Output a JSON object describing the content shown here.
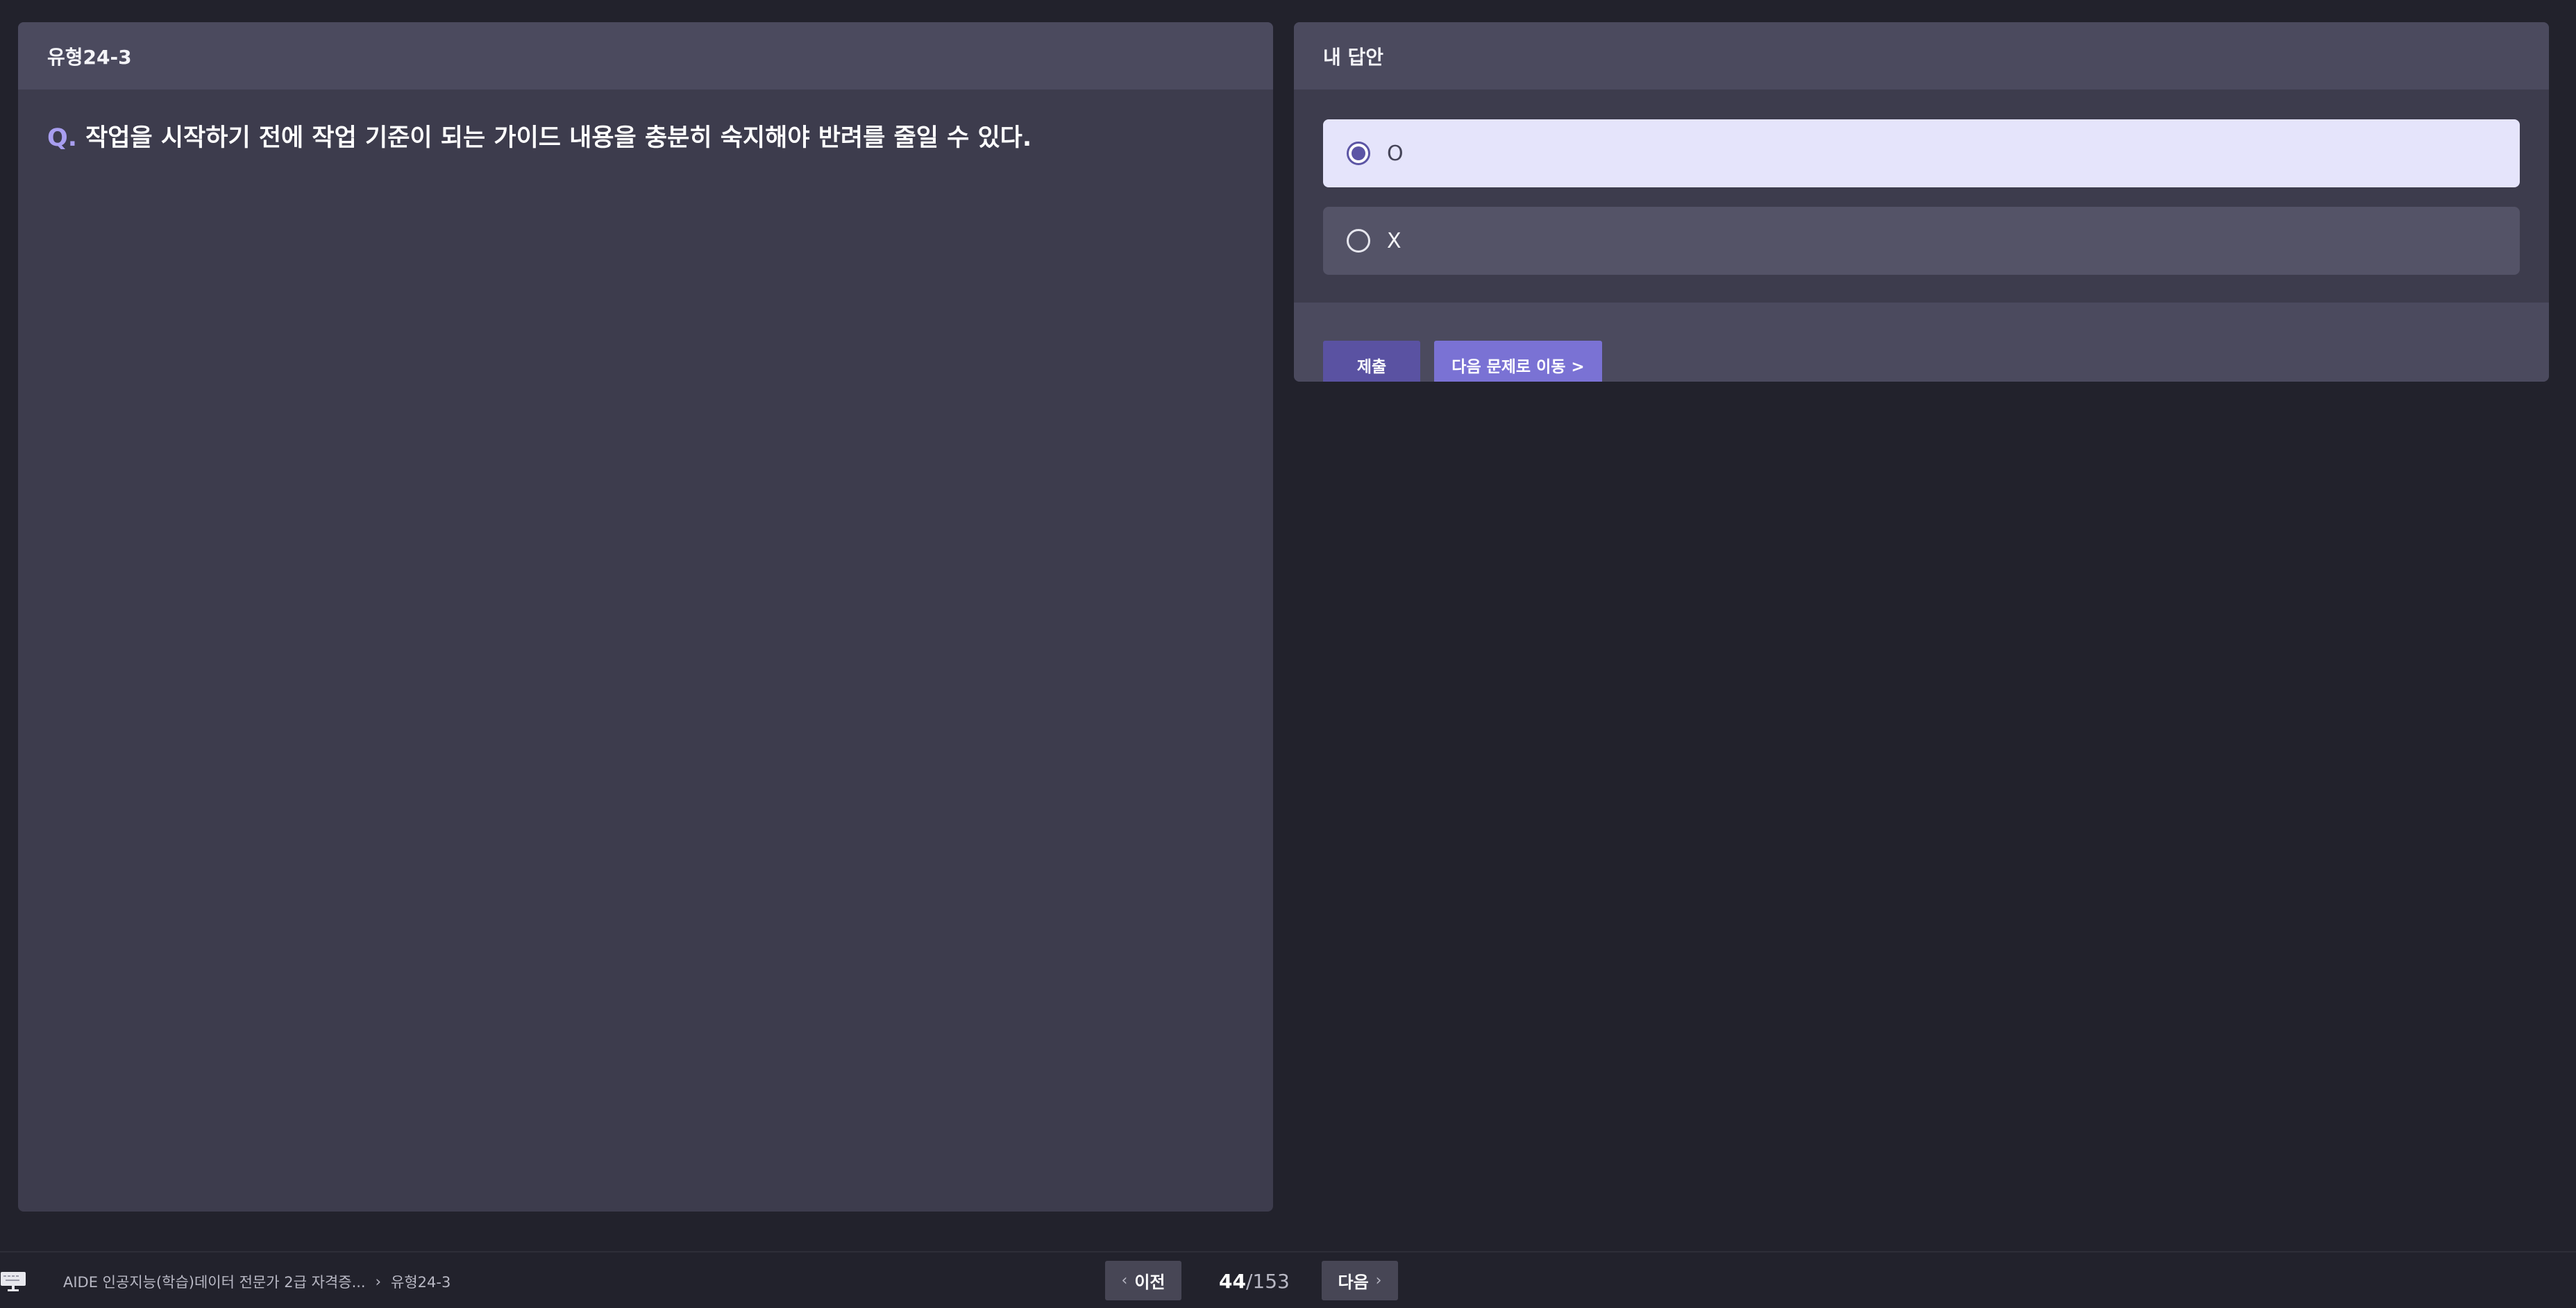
{
  "question_panel": {
    "title": "유형24-3",
    "q_marker": "Q.",
    "question": "작업을 시작하기 전에 작업 기준이 되는 가이드 내용을 충분히 숙지해야 반려를 줄일 수 있다."
  },
  "answer_panel": {
    "title": "내 답안",
    "options": [
      {
        "label": "O",
        "selected": true
      },
      {
        "label": "X",
        "selected": false
      }
    ],
    "submit_label": "제출",
    "next_question_label": "다음 문제로 이동 >"
  },
  "bottom_bar": {
    "breadcrumb": [
      "AIDE 인공지능(학습)데이터 전문가 2급 자격증...",
      "유형24-3"
    ],
    "breadcrumb_separator": "›",
    "prev_label": "이전",
    "next_label": "다음",
    "current_page": "44",
    "total_pages": "/153"
  },
  "colors": {
    "background": "#22222c",
    "panel": "#3d3c4d",
    "panel_header": "#4b4a5e",
    "accent": "#5a52a2",
    "accent_light": "#7a72d4",
    "selected_option": "#e5e4fb"
  },
  "icons": {
    "device": "computer-monitor-icon",
    "prev": "chevron-left-icon",
    "next": "chevron-right-icon"
  }
}
